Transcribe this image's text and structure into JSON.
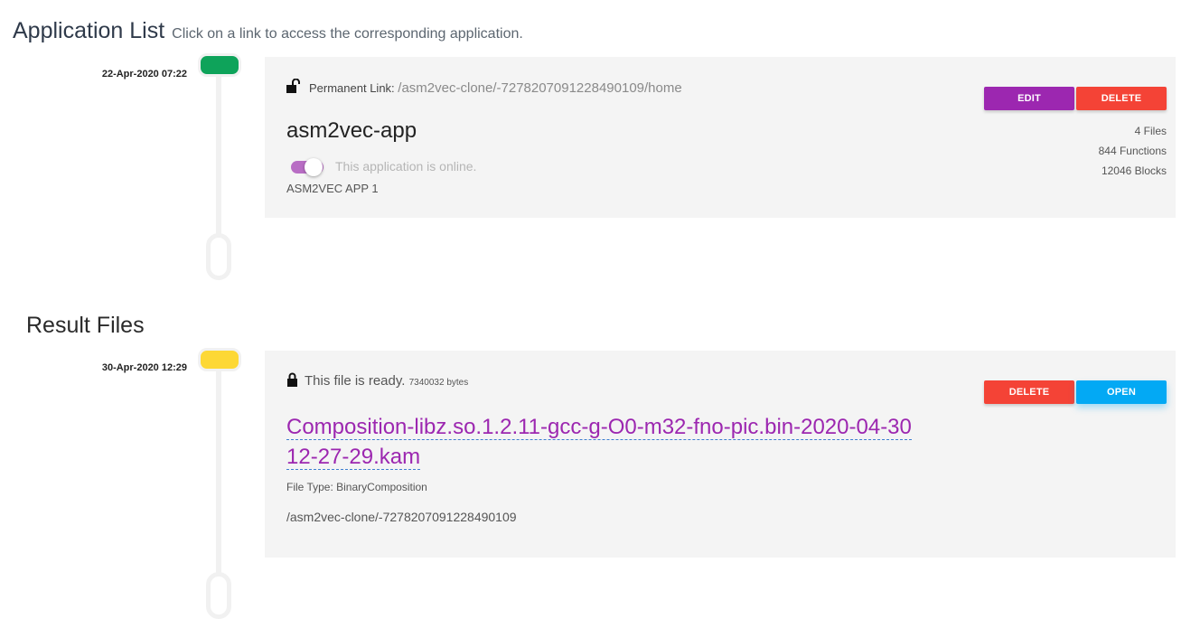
{
  "app_section": {
    "title": "Application List",
    "subtitle": "Click on a link to access the corresponding application.",
    "items": [
      {
        "date": "22-Apr-2020 07:22",
        "status_color": "#0ea35a",
        "link_label": "Permanent Link:",
        "link_path": "/asm2vec-clone/-7278207091228490109/home",
        "name": "asm2vec-app",
        "online_text": "This application is online.",
        "online": true,
        "description": "ASM2VEC APP 1",
        "edit_label": "EDIT",
        "delete_label": "DELETE",
        "stats": [
          "4 Files",
          "844 Functions",
          "12046 Blocks"
        ],
        "lock_icon": "unlocked-padlock-icon"
      }
    ]
  },
  "result_section": {
    "title": "Result Files",
    "items": [
      {
        "date": "30-Apr-2020 12:29",
        "status_color": "#fdd835",
        "status_text": "This file is ready.",
        "size": "7340032 bytes",
        "file_name_line1": "Composition-libz.so.1.2.11-gcc-g-O0-m32-fno-pic.bin-2020-04-30",
        "file_name_line2": "12-27-29.kam",
        "file_type": "File Type: BinaryComposition",
        "path": "/asm2vec-clone/-7278207091228490109",
        "delete_label": "DELETE",
        "open_label": "OPEN",
        "lock_icon": "locked-padlock-icon"
      }
    ]
  },
  "colors": {
    "edit": "#9c27b0",
    "delete": "#f44336",
    "open": "#03a9f4",
    "link": "#9c27b0"
  }
}
